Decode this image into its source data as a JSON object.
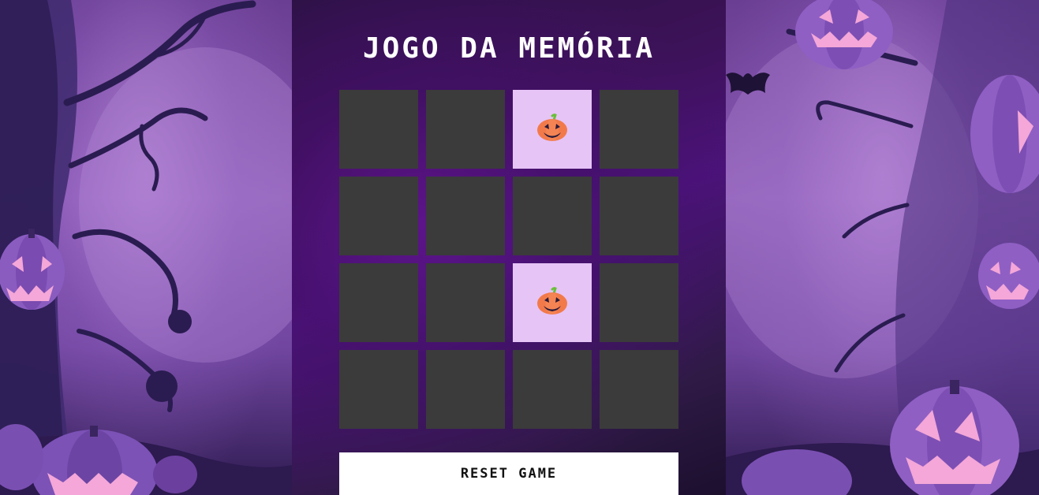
{
  "game": {
    "title": "JOGO DA MEMÓRIA",
    "reset_label": "RESET GAME",
    "cards": [
      {
        "flipped": false,
        "icon": "pumpkin-icon"
      },
      {
        "flipped": false,
        "icon": "pumpkin-icon"
      },
      {
        "flipped": true,
        "icon": "pumpkin-icon"
      },
      {
        "flipped": false,
        "icon": "pumpkin-icon"
      },
      {
        "flipped": false,
        "icon": "pumpkin-icon"
      },
      {
        "flipped": false,
        "icon": "pumpkin-icon"
      },
      {
        "flipped": false,
        "icon": "pumpkin-icon"
      },
      {
        "flipped": false,
        "icon": "pumpkin-icon"
      },
      {
        "flipped": false,
        "icon": "pumpkin-icon"
      },
      {
        "flipped": false,
        "icon": "pumpkin-icon"
      },
      {
        "flipped": true,
        "icon": "pumpkin-icon"
      },
      {
        "flipped": false,
        "icon": "pumpkin-icon"
      },
      {
        "flipped": false,
        "icon": "pumpkin-icon"
      },
      {
        "flipped": false,
        "icon": "pumpkin-icon"
      },
      {
        "flipped": false,
        "icon": "pumpkin-icon"
      },
      {
        "flipped": false,
        "icon": "pumpkin-icon"
      }
    ]
  },
  "colors": {
    "card_back": "#3b3b3b",
    "card_front": "#e6c4f6",
    "pumpkin": "#f27a4a",
    "pumpkin_stem": "#6bbf3a",
    "title": "#ffffff",
    "button_bg": "#ffffff"
  },
  "background": {
    "theme": "halloween-pumpkins-trees",
    "icons": [
      "pumpkin-icon",
      "bat-icon",
      "tree-icon"
    ]
  }
}
